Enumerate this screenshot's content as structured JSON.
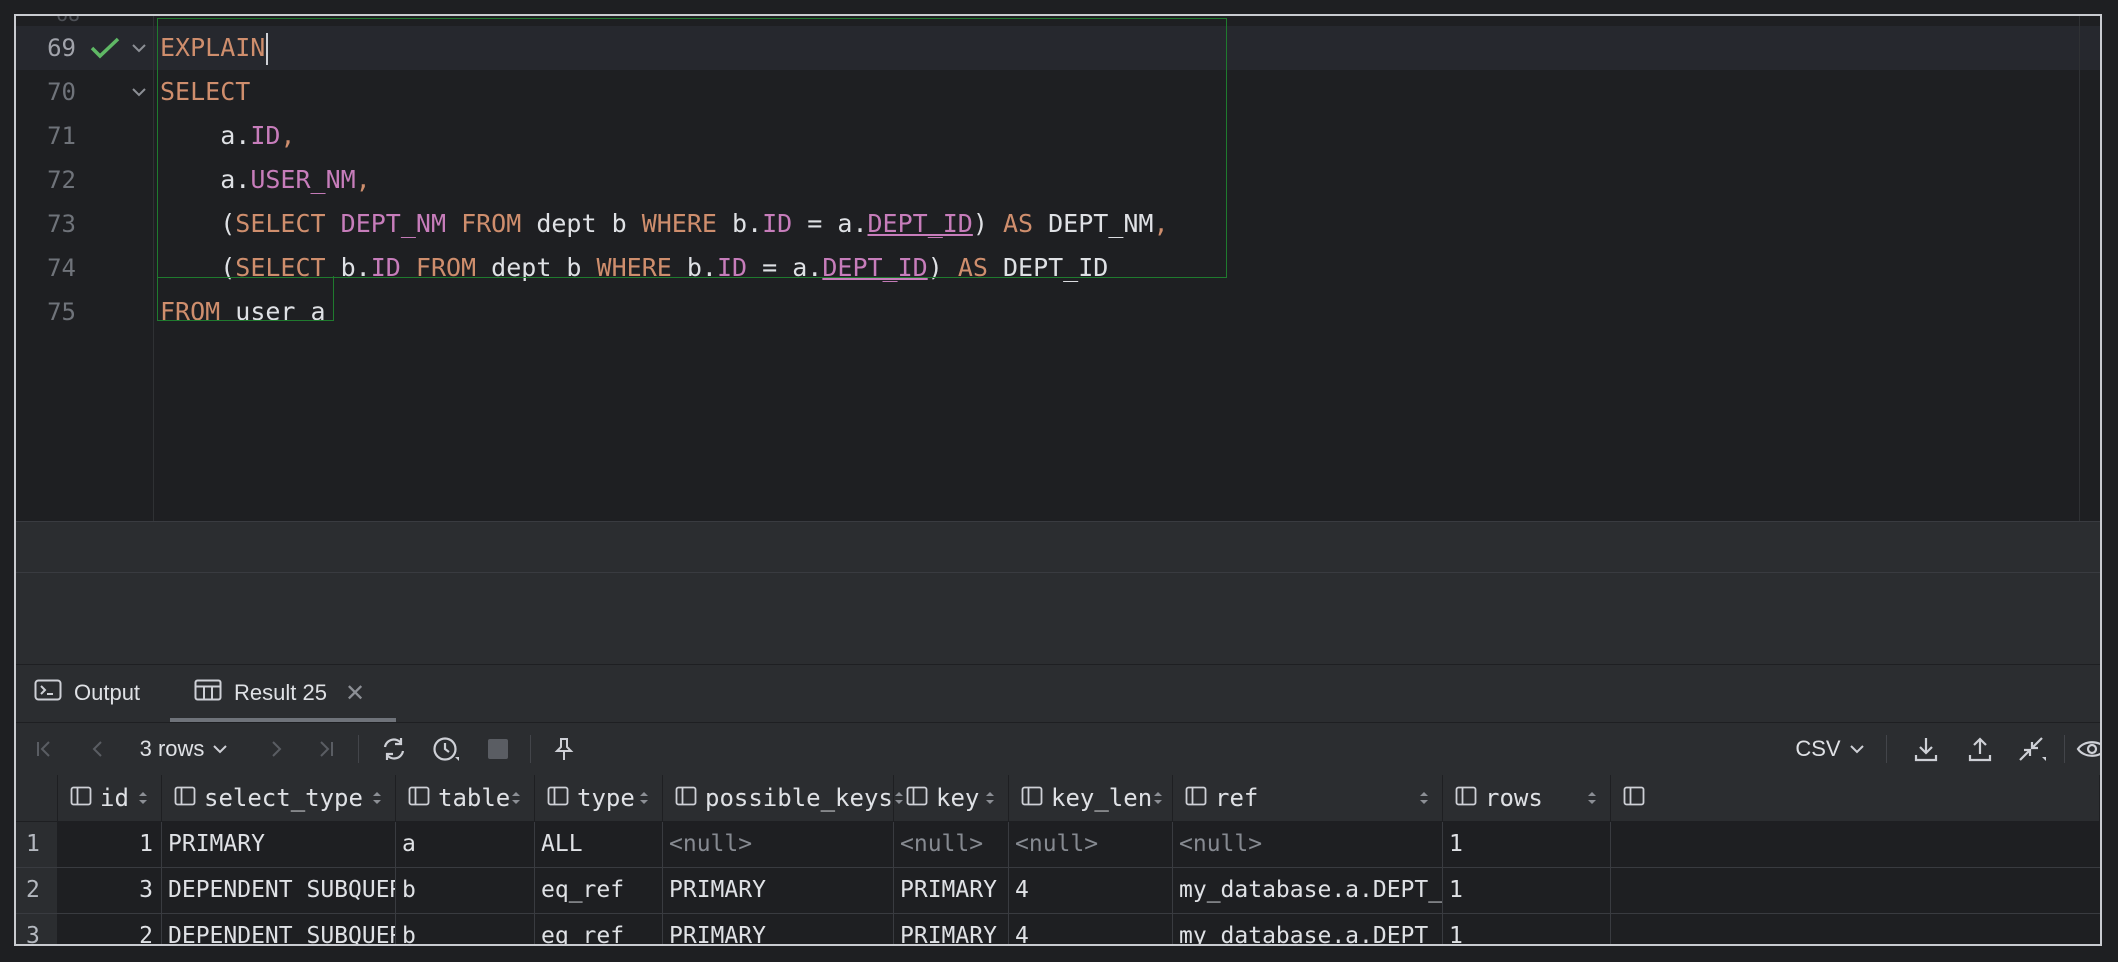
{
  "editor": {
    "lines": [
      {
        "num": "69",
        "tokens": [
          {
            "t": "EXPLAIN",
            "c": "kw"
          }
        ],
        "caret": true,
        "check": true,
        "fold": true
      },
      {
        "num": "70",
        "tokens": [
          {
            "t": "SELECT",
            "c": "kw"
          }
        ],
        "fold": true
      },
      {
        "num": "71",
        "tokens": [
          {
            "t": "    a."
          },
          {
            "t": "ID",
            "c": "fld"
          },
          {
            "t": ",",
            "c": "kw"
          }
        ]
      },
      {
        "num": "72",
        "tokens": [
          {
            "t": "    a."
          },
          {
            "t": "USER_NM",
            "c": "fld"
          },
          {
            "t": ",",
            "c": "kw"
          }
        ]
      },
      {
        "num": "73",
        "tokens": [
          {
            "t": "    ("
          },
          {
            "t": "SELECT",
            "c": "kw"
          },
          {
            "t": " "
          },
          {
            "t": "DEPT_NM",
            "c": "fld"
          },
          {
            "t": " "
          },
          {
            "t": "FROM",
            "c": "kw"
          },
          {
            "t": " dept b "
          },
          {
            "t": "WHERE",
            "c": "kw"
          },
          {
            "t": " b."
          },
          {
            "t": "ID",
            "c": "fld"
          },
          {
            "t": " = a."
          },
          {
            "t": "DEPT_ID",
            "c": "fld u"
          },
          {
            "t": ") "
          },
          {
            "t": "AS",
            "c": "kw"
          },
          {
            "t": " DEPT_NM"
          },
          {
            "t": ",",
            "c": "kw"
          }
        ]
      },
      {
        "num": "74",
        "tokens": [
          {
            "t": "    ("
          },
          {
            "t": "SELECT",
            "c": "kw"
          },
          {
            "t": " b."
          },
          {
            "t": "ID",
            "c": "fld"
          },
          {
            "t": " "
          },
          {
            "t": "FROM",
            "c": "kw"
          },
          {
            "t": " dept b "
          },
          {
            "t": "WHERE",
            "c": "kw"
          },
          {
            "t": " b."
          },
          {
            "t": "ID",
            "c": "fld"
          },
          {
            "t": " = a."
          },
          {
            "t": "DEPT_ID",
            "c": "fld u"
          },
          {
            "t": ") "
          },
          {
            "t": "AS",
            "c": "kw"
          },
          {
            "t": " DEPT_ID"
          }
        ]
      },
      {
        "num": "75",
        "tokens": [
          {
            "t": "FROM",
            "c": "kw"
          },
          {
            "t": " user a"
          }
        ]
      }
    ]
  },
  "tabs": {
    "output_label": "Output",
    "result_label": "Result 25"
  },
  "toolbar": {
    "rows_label": "3 rows",
    "export_format": "CSV"
  },
  "grid": {
    "columns": [
      "id",
      "select_type",
      "table",
      "type",
      "possible_keys",
      "key",
      "key_len",
      "ref",
      "rows"
    ],
    "rows": [
      {
        "n": "1",
        "cells": [
          "1",
          "PRIMARY",
          "a",
          "ALL",
          "<null>",
          "<null>",
          "<null>",
          "<null>",
          "1"
        ]
      },
      {
        "n": "2",
        "cells": [
          "3",
          "DEPENDENT SUBQUERY",
          "b",
          "eq_ref",
          "PRIMARY",
          "PRIMARY",
          "4",
          "my_database.a.DEPT_ID",
          "1"
        ]
      },
      {
        "n": "3",
        "cells": [
          "2",
          "DEPENDENT SUBQUERY",
          "b",
          "eq_ref",
          "PRIMARY",
          "PRIMARY",
          "4",
          "my_database.a.DEPT_ID",
          "1"
        ]
      }
    ]
  },
  "colors": {
    "keyword": "#cf8e6d",
    "field": "#c77dbb",
    "background": "#1e1f22",
    "panel": "#2b2d30",
    "success": "#5fb865"
  }
}
